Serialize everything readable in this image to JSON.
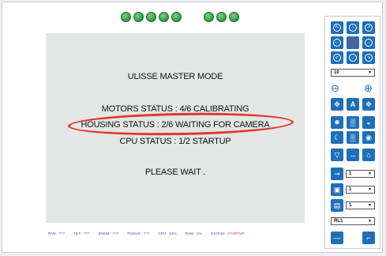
{
  "indicators": {
    "group1_count": 5,
    "group2_count": 3,
    "color": "#3aa54a"
  },
  "main": {
    "title": "ULISSE MASTER MODE",
    "motors": "MOTORS STATUS :  4/6 CALIBRATING",
    "housing": "HOUSING STATUS :  2/6 WAITING FOR CAMERA",
    "cpu": "CPU STATUS :  1/2 STARTUP",
    "wait": "PLEASE WAIT .",
    "highlight_color": "#e03a2e"
  },
  "statusbar": {
    "pan_label": "PAN:",
    "pan_value": "???",
    "tilt_label": "TILT:",
    "tilt_value": "???",
    "zoom_label": "ZOOM:",
    "zoom_value": "???",
    "focus_label": "FOCUS:",
    "focus_value": "???",
    "cpu_label": "CPU:",
    "cpu_value": "54%",
    "ram_label": "RAM:",
    "ram_value": "5%",
    "status_label": "STATUS:",
    "status_value": "STARTUP"
  },
  "sidebar": {
    "speed_select": "10",
    "zoom_out_icon": "zoom-out-icon",
    "zoom_in_icon": "zoom-in-icon",
    "preset_select": "1",
    "save_select": "1",
    "wiper_select": "1",
    "relay_select": "RL1",
    "accent": "#1f6fb8"
  }
}
